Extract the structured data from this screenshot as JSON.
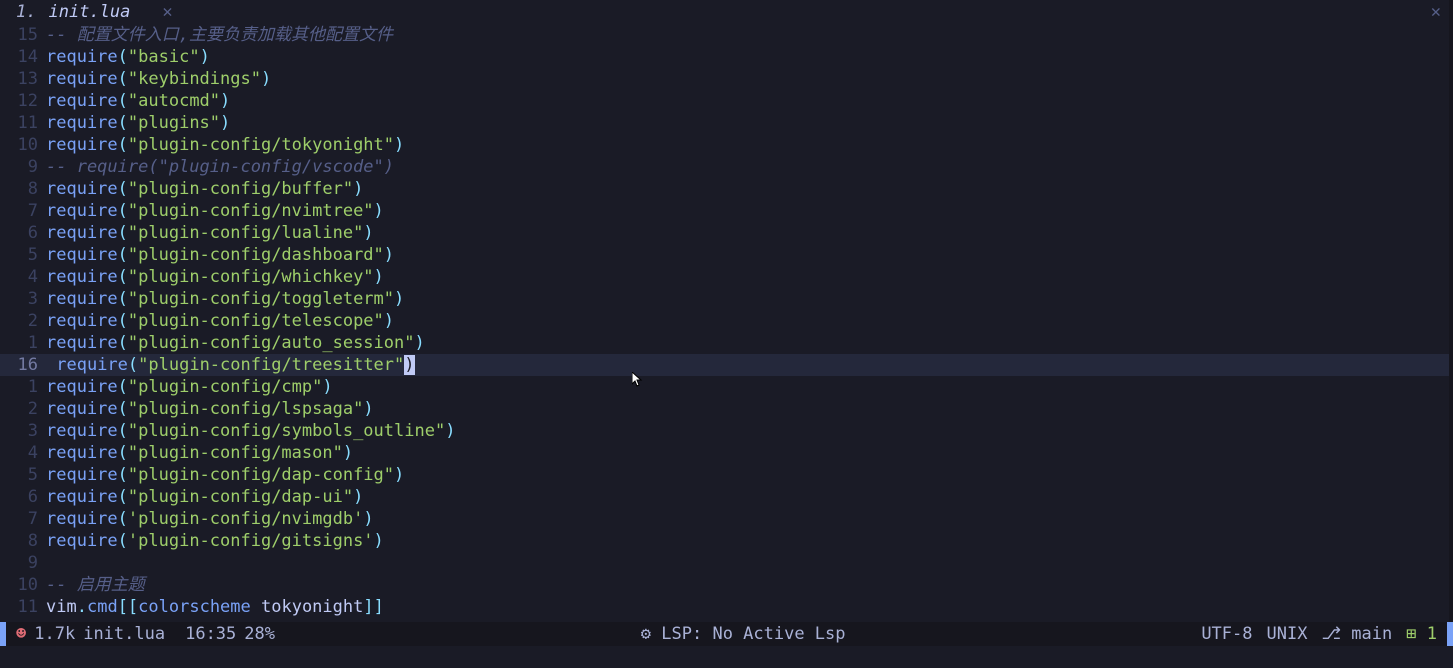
{
  "tab": {
    "number": "1.",
    "icon": "",
    "name": "init.lua",
    "close": "✕"
  },
  "window_close": "✕",
  "lines": [
    {
      "num": "15",
      "type": "comment",
      "text": "-- 配置文件入口,主要负责加载其他配置文件"
    },
    {
      "num": "14",
      "type": "require",
      "arg": "\"basic\""
    },
    {
      "num": "13",
      "type": "require",
      "arg": "\"keybindings\""
    },
    {
      "num": "12",
      "type": "require",
      "arg": "\"autocmd\""
    },
    {
      "num": "11",
      "type": "require",
      "arg": "\"plugins\""
    },
    {
      "num": "10",
      "type": "require",
      "arg": "\"plugin-config/tokyonight\""
    },
    {
      "num": "9",
      "type": "comment",
      "text": "-- require(\"plugin-config/vscode\")"
    },
    {
      "num": "8",
      "type": "require",
      "arg": "\"plugin-config/buffer\""
    },
    {
      "num": "7",
      "type": "require",
      "arg": "\"plugin-config/nvimtree\""
    },
    {
      "num": "6",
      "type": "require",
      "arg": "\"plugin-config/lualine\""
    },
    {
      "num": "5",
      "type": "require",
      "arg": "\"plugin-config/dashboard\""
    },
    {
      "num": "4",
      "type": "require",
      "arg": "\"plugin-config/whichkey\""
    },
    {
      "num": "3",
      "type": "require",
      "arg": "\"plugin-config/toggleterm\""
    },
    {
      "num": "2",
      "type": "require",
      "arg": "\"plugin-config/telescope\""
    },
    {
      "num": "1",
      "type": "require",
      "arg": "\"plugin-config/auto_session\""
    },
    {
      "num": "16",
      "type": "require_cursor",
      "arg_pre": "\"plugin-config/treesitter\"",
      "cursor_char": ")",
      "abs": true
    },
    {
      "num": "1",
      "type": "require",
      "arg": "\"plugin-config/cmp\""
    },
    {
      "num": "2",
      "type": "require",
      "arg": "\"plugin-config/lspsaga\""
    },
    {
      "num": "3",
      "type": "require",
      "arg": "\"plugin-config/symbols_outline\""
    },
    {
      "num": "4",
      "type": "require",
      "arg": "\"plugin-config/mason\""
    },
    {
      "num": "5",
      "type": "require",
      "arg": "\"plugin-config/dap-config\""
    },
    {
      "num": "6",
      "type": "require",
      "arg": "\"plugin-config/dap-ui\""
    },
    {
      "num": "7",
      "type": "require",
      "arg": "'plugin-config/nvimgdb'"
    },
    {
      "num": "8",
      "type": "require",
      "arg": "'plugin-config/gitsigns'"
    },
    {
      "num": "9",
      "type": "blank"
    },
    {
      "num": "10",
      "type": "comment",
      "text": "-- 启用主题"
    },
    {
      "num": "11",
      "type": "vimcmd",
      "ident": "vim",
      "dot": ".",
      "member": "cmd",
      "open": "[[",
      "scheme_kw": "colorscheme",
      "scheme_val": " tokyonight",
      "close": "]]"
    }
  ],
  "status": {
    "filesize": "1.7k",
    "filename": "init.lua",
    "pos": "16:35",
    "percent": "28%",
    "lsp_icon": "⚙",
    "lsp": "LSP: No Active Lsp",
    "encoding": "UTF-8",
    "fileformat": "UNIX",
    "git_icon": "⎇",
    "branch": "main",
    "diff_add_icon": "⊞",
    "diff_add": "1"
  }
}
